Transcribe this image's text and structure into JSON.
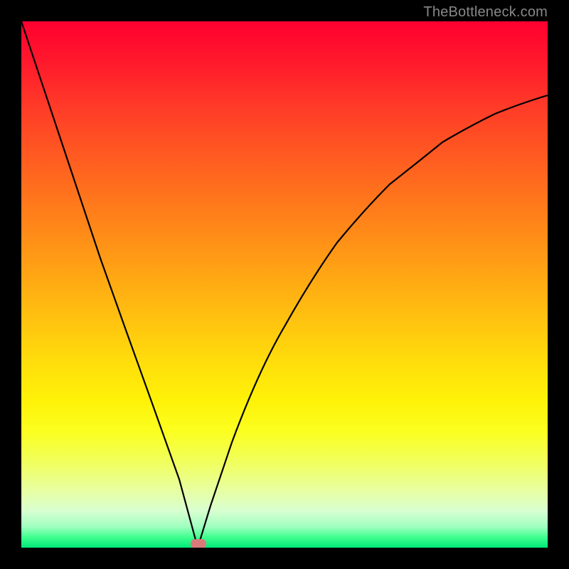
{
  "watermark": "TheBottleneck.com",
  "chart_data": {
    "type": "line",
    "title": "",
    "xlabel": "",
    "ylabel": "",
    "xlim": [
      0,
      100
    ],
    "ylim": [
      0,
      100
    ],
    "grid": false,
    "legend": false,
    "background_gradient": {
      "orientation": "vertical",
      "stops": [
        {
          "pos": 0.0,
          "color": "#ff0030"
        },
        {
          "pos": 0.5,
          "color": "#ffb010"
        },
        {
          "pos": 0.75,
          "color": "#fff208"
        },
        {
          "pos": 1.0,
          "color": "#00e878"
        }
      ]
    },
    "series": [
      {
        "name": "bottleneck-curve",
        "x": [
          0,
          5,
          10,
          15,
          20,
          25,
          30,
          33.5,
          36,
          40,
          45,
          50,
          55,
          60,
          65,
          70,
          75,
          80,
          85,
          90,
          95,
          100
        ],
        "y": [
          100,
          85,
          70,
          55,
          41,
          27,
          13,
          0,
          8,
          20,
          32,
          42,
          51,
          58,
          64,
          69,
          73,
          77,
          80,
          82.5,
          84.5,
          86
        ]
      }
    ],
    "marker": {
      "name": "minimum-point",
      "x": 33.5,
      "y": 0,
      "color": "#d97a7a",
      "shape": "rounded-rect"
    }
  }
}
